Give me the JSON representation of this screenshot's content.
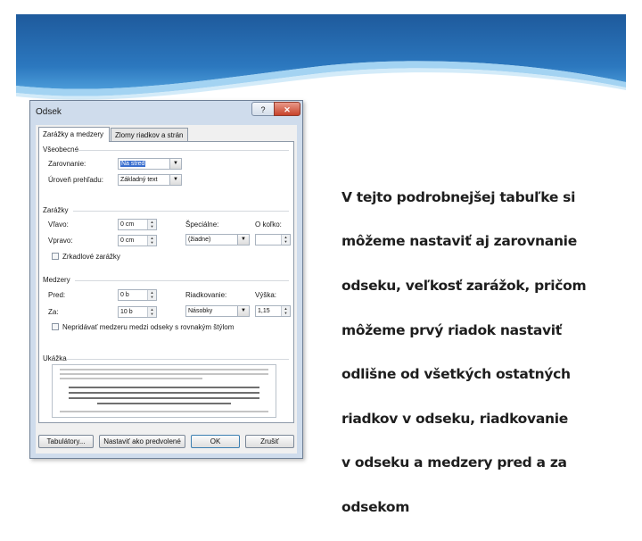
{
  "slide": {
    "text": "V tejto podrobnejšej tabuľke si môžeme nastaviť aj zarovnanie odseku, veľkosť zarážok, pričom môžeme prvý riadok nastaviť odlišne od všetkých ostatných riadkov v odseku, riadkovanie v odseku a medzery pred a za odsekom",
    "lines": [
      "V tejto podrobnejšej tabuľke si",
      "môžeme nastaviť aj zarovnanie",
      "odseku, veľkosť zarážok, pričom",
      "môžeme prvý riadok nastaviť",
      "odlišne od všetkých ostatných",
      "riadkov v odseku, riadkovanie",
      "v odseku a medzery pred a za",
      "odsekom"
    ],
    "colors": {
      "wave_dark": "#1f5fa3",
      "wave_mid": "#2f7fc6",
      "wave_light": "#5aa8e0",
      "accent_line": "#9ed0f0"
    }
  },
  "dialog": {
    "title": "Odsek",
    "help_button": "?",
    "close_button": "✕",
    "tabs": [
      "Zarážky a medzery",
      "Zlomy riadkov a strán"
    ],
    "general": {
      "heading": "Všeobecné",
      "alignment_label": "Zarovnanie:",
      "alignment_value": "Na stred",
      "outline_label": "Úroveň prehľadu:",
      "outline_value": "Základný text"
    },
    "indent": {
      "heading": "Zarážky",
      "left_label": "Vľavo:",
      "left_value": "0 cm",
      "right_label": "Vpravo:",
      "right_value": "0 cm",
      "special_label": "Špeciálne:",
      "special_value": "(žiadne)",
      "by_label": "O koľko:",
      "by_value": "",
      "mirror_label": "Zrkadlové zarážky"
    },
    "spacing": {
      "heading": "Medzery",
      "before_label": "Pred:",
      "before_value": "0 b",
      "after_label": "Za:",
      "after_value": "10 b",
      "line_label": "Riadkovanie:",
      "line_value": "Násobky",
      "at_label": "Výška:",
      "at_value": "1,15",
      "dont_add_label": "Nepridávať medzeru medzi odseky s rovnakým štýlom"
    },
    "preview": {
      "heading": "Ukážka"
    },
    "buttons": {
      "tabs": "Tabulátory...",
      "default": "Nastaviť ako predvolené",
      "ok": "OK",
      "cancel": "Zrušiť"
    },
    "colors": {
      "frame": "#cfdcec",
      "selection": "#3a6fcf",
      "close": "#c7432b"
    }
  }
}
